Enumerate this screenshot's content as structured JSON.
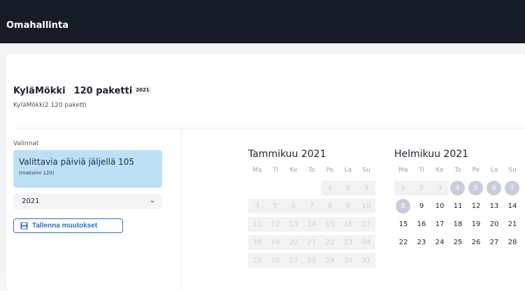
{
  "header": {
    "title": "Omahallinta"
  },
  "package": {
    "name": "KyläMökki",
    "subtitle_title": "120 paketti",
    "year_badge": "2021",
    "subtitle": "KyläMökki2 120 paketti"
  },
  "selection": {
    "label": "Valinnat",
    "remaining_text": "Valittavia päiviä jäljellä 105",
    "max_text": "(maksimi 120)",
    "year_value": "2021",
    "save_label": "Tallenna muutokset"
  },
  "weekdays": [
    "Ma",
    "Ti",
    "Ke",
    "To",
    "Pe",
    "La",
    "Su"
  ],
  "months": [
    {
      "title": "Tammikuu 2021",
      "rows": [
        [
          "",
          "",
          "",
          "",
          "1",
          "2",
          "3"
        ],
        [
          "4",
          "5",
          "6",
          "7",
          "8",
          "9",
          "10"
        ],
        [
          "11",
          "12",
          "13",
          "14",
          "15",
          "16",
          "17"
        ],
        [
          "18",
          "19",
          "20",
          "21",
          "22",
          "23",
          "24"
        ],
        [
          "25",
          "26",
          "27",
          "28",
          "29",
          "30",
          "31"
        ]
      ],
      "states": [
        [
          "empty",
          "empty",
          "empty",
          "empty",
          "disabled",
          "disabled",
          "disabled"
        ],
        [
          "disabled",
          "disabled",
          "disabled",
          "disabled",
          "disabled",
          "disabled",
          "disabled"
        ],
        [
          "disabled",
          "disabled",
          "disabled",
          "disabled",
          "disabled",
          "disabled",
          "disabled"
        ],
        [
          "disabled",
          "disabled",
          "disabled",
          "disabled",
          "disabled",
          "disabled",
          "disabled"
        ],
        [
          "disabled",
          "disabled",
          "disabled",
          "disabled",
          "disabled",
          "disabled",
          "disabled"
        ]
      ]
    },
    {
      "title": "Helmikuu 2021",
      "rows": [
        [
          "1",
          "2",
          "3",
          "4",
          "5",
          "6",
          "7"
        ],
        [
          "8",
          "9",
          "10",
          "11",
          "12",
          "13",
          "14"
        ],
        [
          "15",
          "16",
          "17",
          "18",
          "19",
          "20",
          "21"
        ],
        [
          "22",
          "23",
          "24",
          "25",
          "26",
          "27",
          "28"
        ]
      ],
      "states": [
        [
          "disabled",
          "disabled",
          "disabled",
          "reserved",
          "reserved",
          "reserved",
          "reserved"
        ],
        [
          "today",
          "normal",
          "normal",
          "normal",
          "normal",
          "normal",
          "normal"
        ],
        [
          "normal",
          "normal",
          "normal",
          "normal",
          "normal",
          "normal",
          "normal"
        ],
        [
          "normal",
          "normal",
          "normal",
          "normal",
          "normal",
          "normal",
          "normal"
        ]
      ]
    }
  ],
  "colors": {
    "header_bg": "#161c26",
    "info_box_bg": "#bde0f6",
    "accent": "#2f6fbf",
    "reserved_day": "#c8ccdc"
  }
}
